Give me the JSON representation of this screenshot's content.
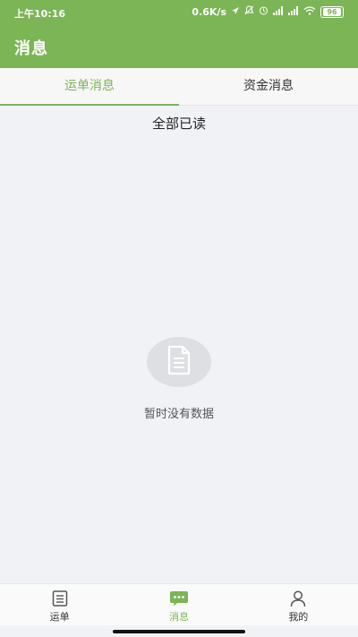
{
  "status_bar": {
    "time": "上午10:16",
    "speed": "0.6K/s",
    "battery": "96",
    "icons": [
      "navigation-icon",
      "mute-icon",
      "alarm-icon",
      "signal-icon",
      "signal-icon",
      "wifi-icon",
      "battery-icon"
    ]
  },
  "header": {
    "title": "消息"
  },
  "tabs": [
    {
      "label": "运单消息",
      "active": true
    },
    {
      "label": "资金消息",
      "active": false
    }
  ],
  "actions": {
    "mark_all_read": "全部已读"
  },
  "empty_state": {
    "icon": "document-icon",
    "text": "暂时没有数据"
  },
  "bottom_nav": [
    {
      "label": "运单",
      "icon": "waybill-icon",
      "active": false
    },
    {
      "label": "消息",
      "icon": "message-icon",
      "active": true
    },
    {
      "label": "我的",
      "icon": "user-icon",
      "active": false
    }
  ],
  "colors": {
    "brand": "#7bb555",
    "background": "#f1f2f6"
  }
}
